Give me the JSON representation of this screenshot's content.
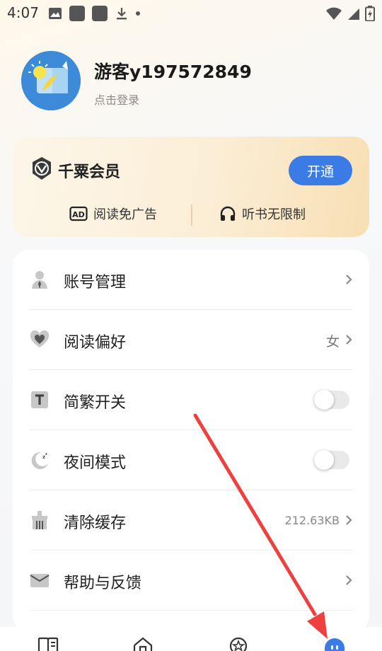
{
  "status_bar": {
    "time": "4:07",
    "left_icons": [
      "image-icon",
      "app-icon",
      "app-icon",
      "download-icon",
      "dot-icon"
    ],
    "right_icons": [
      "wifi-icon",
      "signal-icon",
      "battery-icon"
    ]
  },
  "profile": {
    "username": "游客y197572849",
    "login_hint": "点击登录"
  },
  "vip": {
    "title": "千粟会员",
    "open_button": "开通",
    "features": [
      {
        "icon": "ad-icon",
        "label": "阅读免广告"
      },
      {
        "icon": "headphones-icon",
        "label": "听书无限制"
      }
    ]
  },
  "settings": [
    {
      "icon": "person-icon",
      "label": "账号管理",
      "value": "",
      "control": "chevron"
    },
    {
      "icon": "heart-icon",
      "label": "阅读偏好",
      "value": "女",
      "control": "chevron"
    },
    {
      "icon": "text-t-icon",
      "label": "简繁开关",
      "value": "",
      "control": "toggle",
      "on": false
    },
    {
      "icon": "moon-icon",
      "label": "夜间模式",
      "value": "",
      "control": "toggle",
      "on": false
    },
    {
      "icon": "broom-icon",
      "label": "清除缓存",
      "value": "212.63KB",
      "control": "chevron"
    },
    {
      "icon": "mail-icon",
      "label": "帮助与反馈",
      "value": "",
      "control": "chevron"
    }
  ],
  "bottom_nav": [
    {
      "name": "bookshelf",
      "icon": "book-icon",
      "active": false
    },
    {
      "name": "home",
      "icon": "home-icon",
      "active": false
    },
    {
      "name": "discover",
      "icon": "star-icon",
      "active": false
    },
    {
      "name": "mine",
      "icon": "robot-icon",
      "active": true
    }
  ],
  "colors": {
    "accent": "#3b7be6",
    "annotation_arrow": "#ef4040",
    "vip_gradient_end": "#f8dfb3"
  },
  "annotation": {
    "type": "arrow",
    "points_to": "bottom-nav-mine"
  }
}
